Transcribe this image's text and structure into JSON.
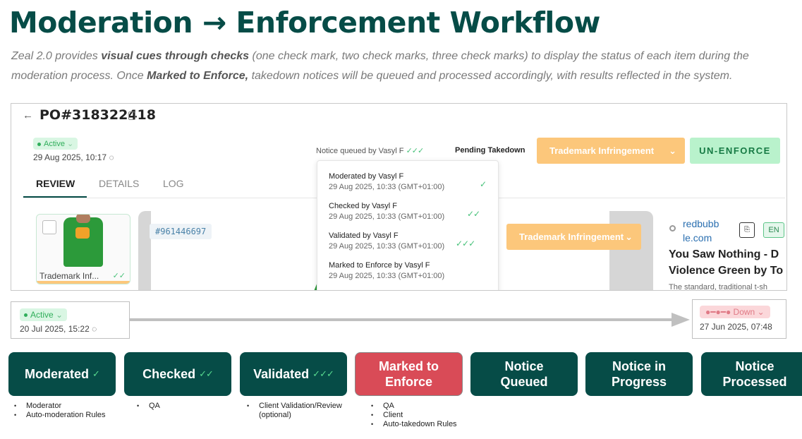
{
  "title": "Moderation → Enforcement Workflow",
  "intro": {
    "p1": "Zeal 2.0 provides ",
    "b1": "visual cues through checks",
    "p2": " (one check mark, two check marks, three check marks) to display the status of each item during the moderation process. Once ",
    "b2": "Marked to Enforce,",
    "p3": " takedown notices will be queued and processed accordingly, with results reflected in the system."
  },
  "screenshot": {
    "back_icon": "←",
    "po_number": "PO#318322418",
    "status_badge": "Active",
    "status_date": "29 Aug 2025, 10:17",
    "refresh_icon": "◌",
    "notice_text": "Notice queued by Vasyl F",
    "notice_checks": "✓✓✓",
    "pending_text": "Pending Takedown",
    "trademark_button": "Trademark Infringement",
    "chevron": "⌄",
    "unenforce_button": "UN-ENFORCE",
    "tabs": [
      "REVIEW",
      "DETAILS",
      "LOG"
    ],
    "thumb_label": "Trademark Inf...",
    "thumb_checks": "✓✓",
    "item_id": "#961446697",
    "dropdown": [
      {
        "name": "Moderated by Vasyl F",
        "time": "29 Aug 2025, 10:33 (GMT+01:00)",
        "checks": "✓"
      },
      {
        "name": "Checked by Vasyl F",
        "time": "29 Aug 2025, 10:33 (GMT+01:00)",
        "checks": "✓✓"
      },
      {
        "name": "Validated by Vasyl F",
        "time": "29 Aug 2025, 10:33 (GMT+01:00)",
        "checks": "✓✓✓"
      },
      {
        "name": "Marked to Enforce by Vasyl F",
        "time": "29 Aug 2025, 10:33 (GMT+01:00)",
        "checks": ""
      }
    ],
    "trademark_button2": "Trademark Infringement",
    "source_line1": "redbubb",
    "source_line2": "le.com",
    "language": "EN",
    "listing_title_1": "You Saw Nothing - D",
    "listing_title_2": "Violence Green by To",
    "listing_desc": "The standard, traditional t-sh"
  },
  "timeline": {
    "left_badge": "Active",
    "left_date": "20 Jul 2025, 15:22",
    "right_badge": "Down",
    "right_date": "27 Jun 2025, 07:48"
  },
  "stages": [
    {
      "label": "Moderated",
      "checks": "✓",
      "bullets": [
        "Moderator",
        "Auto-moderation Rules"
      ]
    },
    {
      "label": "Checked",
      "checks": "✓✓",
      "bullets": [
        "QA"
      ]
    },
    {
      "label": "Validated",
      "checks": "✓✓✓",
      "bullets": [
        "Client Validation/Review (optional)"
      ]
    },
    {
      "label": "Marked to Enforce",
      "checks": "",
      "bullets": [
        "QA",
        "Client",
        "Auto-takedown Rules"
      ]
    },
    {
      "label": "Notice Queued",
      "checks": "",
      "bullets": []
    },
    {
      "label": "Notice in Progress",
      "checks": "",
      "bullets": []
    },
    {
      "label": "Notice Processed",
      "checks": "",
      "bullets": []
    }
  ],
  "colors": {
    "brand_teal": "#064c47",
    "enforce_red": "#d94b57",
    "check_green": "#57d98f",
    "trademark_orange": "#fcc77b",
    "unenforce_green": "#b9f2cc"
  }
}
